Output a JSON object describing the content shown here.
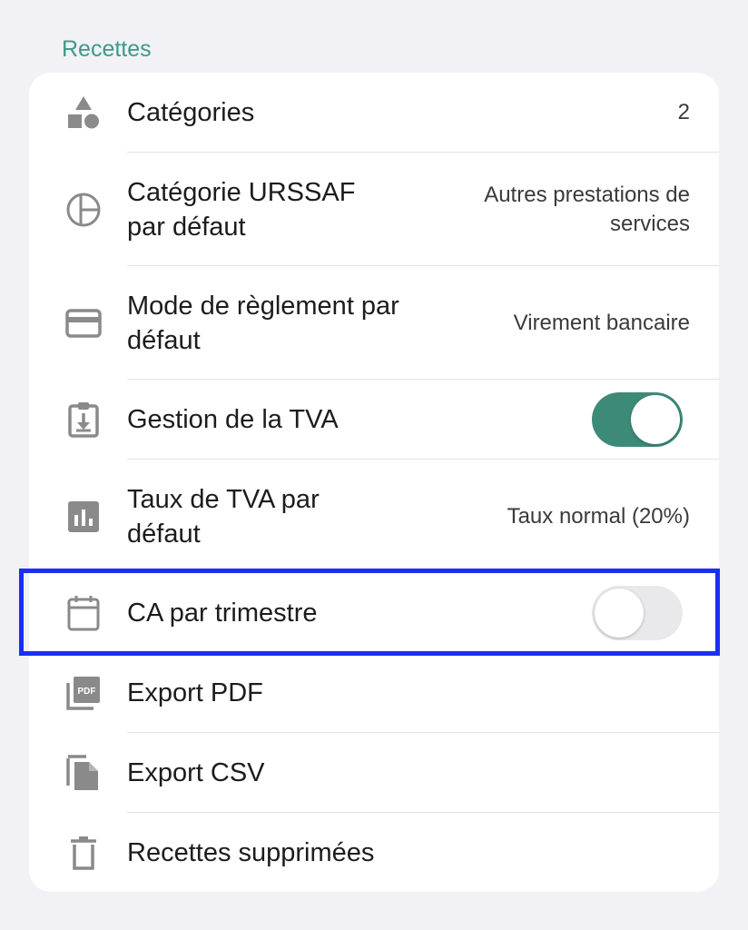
{
  "section": {
    "title": "Recettes"
  },
  "rows": [
    {
      "label": "Catégories",
      "value": "2",
      "icon": "shapes-icon"
    },
    {
      "label": "Catégorie URSSAF par défaut",
      "value": "Autres prestations de services",
      "icon": "pie-chart-icon"
    },
    {
      "label": "Mode de règlement par défaut",
      "value": "Virement bancaire",
      "icon": "credit-card-icon"
    },
    {
      "label": "Gestion de la TVA",
      "toggle": "on",
      "icon": "clipboard-download-icon"
    },
    {
      "label": "Taux de TVA par défaut",
      "value": "Taux normal (20%)",
      "icon": "bar-chart-icon"
    },
    {
      "label": "CA par trimestre",
      "toggle": "off",
      "icon": "calendar-icon"
    },
    {
      "label": "Export PDF",
      "icon": "pdf-icon"
    },
    {
      "label": "Export CSV",
      "icon": "file-copy-icon"
    },
    {
      "label": "Recettes supprimées",
      "icon": "trash-icon"
    }
  ],
  "colors": {
    "accent": "#3d8a78",
    "section_title": "#3d9a88",
    "highlight": "#1a2ff2"
  }
}
